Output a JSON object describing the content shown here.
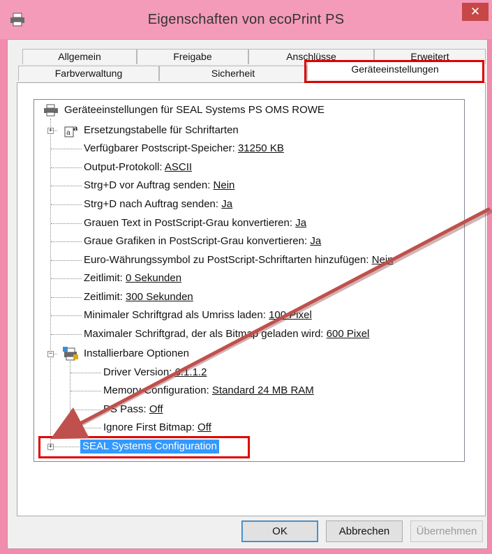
{
  "window": {
    "title": "Eigenschaften von ecoPrint PS",
    "close_glyph": "✕"
  },
  "tabs": {
    "row1": [
      "Allgemein",
      "Freigabe",
      "Anschlüsse",
      "Erweitert"
    ],
    "row2": [
      "Farbverwaltung",
      "Sicherheit",
      "Geräteeinstellungen"
    ],
    "active": "Geräteeinstellungen"
  },
  "tree": {
    "root": "Geräteeinstellungen für SEAL Systems PS OMS ROWE",
    "font_table": "Ersetzungstabelle für Schriftarten",
    "items": [
      {
        "label": "Verfügbarer Postscript-Speicher: ",
        "value": "31250 KB"
      },
      {
        "label": "Output-Protokoll: ",
        "value": "ASCII"
      },
      {
        "label": "Strg+D vor Auftrag senden: ",
        "value": "Nein"
      },
      {
        "label": "Strg+D nach Auftrag senden: ",
        "value": "Ja"
      },
      {
        "label": "Grauen Text in PostScript-Grau konvertieren: ",
        "value": "Ja"
      },
      {
        "label": "Graue Grafiken in PostScript-Grau konvertieren: ",
        "value": "Ja"
      },
      {
        "label": "Euro-Währungssymbol zu PostScript-Schriftarten hinzufügen: ",
        "value": "Nein"
      },
      {
        "label": "Zeitlimit: ",
        "value": "0 Sekunden"
      },
      {
        "label": "Zeitlimit: ",
        "value": "300 Sekunden"
      },
      {
        "label": "Minimaler Schriftgrad als Umriss laden: ",
        "value": "100 Pixel"
      },
      {
        "label": "Maximaler Schriftgrad, der als Bitmap geladen wird: ",
        "value": "600 Pixel"
      }
    ],
    "installable": "Installierbare Optionen",
    "sub_items": [
      {
        "label": "Driver Version: ",
        "value": "6.1.1.2"
      },
      {
        "label": "Memory Configuration: ",
        "value": "Standard 24 MB RAM"
      },
      {
        "label": "PS Pass: ",
        "value": "Off"
      },
      {
        "label": "Ignore First Bitmap: ",
        "value": "Off"
      }
    ],
    "selected": "SEAL Systems Configuration",
    "expand_glyph": "+",
    "collapse_glyph": "−"
  },
  "buttons": {
    "ok": "OK",
    "cancel": "Abbrechen",
    "apply": "Übernehmen"
  },
  "colors": {
    "highlight": "#e00000",
    "arrow": "#c0504d",
    "selection": "#3399ff",
    "titlebar": "#f49bb9"
  },
  "icons": [
    "printer-icon",
    "font-table-icon",
    "installable-options-icon",
    "close-icon"
  ]
}
